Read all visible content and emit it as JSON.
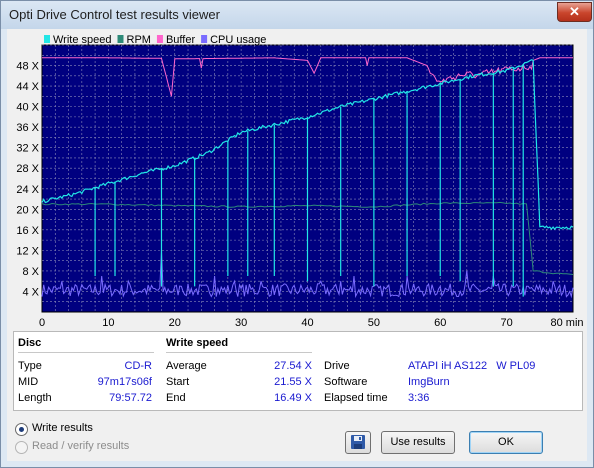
{
  "window": {
    "title": "Opti Drive Control test results viewer",
    "close_glyph": "✕"
  },
  "chart_data": {
    "type": "line",
    "title": "",
    "xlabel": "",
    "ylabel": "",
    "x_unit": "min",
    "xlim": [
      0,
      80
    ],
    "ylim": [
      0,
      52
    ],
    "x_ticks": [
      "0",
      "10",
      "20",
      "30",
      "40",
      "50",
      "60",
      "70",
      "80 min"
    ],
    "y_ticks": [
      "4 X",
      "8 X",
      "12 X",
      "16 X",
      "20 X",
      "24 X",
      "28 X",
      "32 X",
      "36 X",
      "40 X",
      "44 X",
      "48 X"
    ],
    "grid": true,
    "legend_position": "top-left",
    "background": "#000080",
    "series": [
      {
        "name": "Write speed",
        "color": "#22e6e6",
        "points": [
          [
            0,
            21.5
          ],
          [
            5,
            23
          ],
          [
            10,
            25
          ],
          [
            15,
            27
          ],
          [
            20,
            28.5
          ],
          [
            25,
            31
          ],
          [
            30,
            35
          ],
          [
            35,
            36.5
          ],
          [
            40,
            38
          ],
          [
            45,
            40
          ],
          [
            50,
            41.5
          ],
          [
            55,
            43
          ],
          [
            60,
            44.5
          ],
          [
            65,
            46
          ],
          [
            70,
            47
          ],
          [
            72,
            48
          ],
          [
            74,
            49
          ],
          [
            75,
            16.5
          ],
          [
            80,
            16.5
          ]
        ],
        "drops": [
          [
            8,
            7
          ],
          [
            11,
            7
          ],
          [
            18,
            5
          ],
          [
            23,
            5
          ],
          [
            28,
            7
          ],
          [
            31,
            7
          ],
          [
            35,
            7
          ],
          [
            40,
            6
          ],
          [
            45,
            7
          ],
          [
            50,
            5
          ],
          [
            55,
            7
          ],
          [
            60,
            7
          ],
          [
            63,
            6
          ],
          [
            68,
            5
          ],
          [
            71,
            5
          ],
          [
            72.5,
            3
          ]
        ]
      },
      {
        "name": "RPM",
        "color": "#2e8a78",
        "points": [
          [
            0,
            21
          ],
          [
            10,
            21
          ],
          [
            20,
            20.7
          ],
          [
            30,
            20.5
          ],
          [
            40,
            20.7
          ],
          [
            50,
            20.5
          ],
          [
            60,
            21.2
          ],
          [
            70,
            21.2
          ],
          [
            73,
            21
          ],
          [
            74,
            8
          ],
          [
            80,
            7.2
          ]
        ]
      },
      {
        "name": "Buffer",
        "color": "#ff66cc",
        "points": [
          [
            0,
            49.5
          ],
          [
            10,
            49.5
          ],
          [
            18,
            49.4
          ],
          [
            19.5,
            42
          ],
          [
            20,
            49.3
          ],
          [
            35,
            49.5
          ],
          [
            40,
            49
          ],
          [
            41,
            46.5
          ],
          [
            42,
            49.5
          ],
          [
            55,
            49.5
          ],
          [
            58,
            48
          ],
          [
            60,
            45.5
          ],
          [
            63,
            47
          ],
          [
            66,
            47
          ],
          [
            70,
            48
          ],
          [
            73,
            48.5
          ],
          [
            75,
            49.5
          ],
          [
            80,
            49.5
          ]
        ],
        "dips": [
          [
            24,
            47.5
          ],
          [
            41,
            46.5
          ],
          [
            49,
            48
          ],
          [
            61,
            45.5
          ]
        ]
      },
      {
        "name": "CPU usage",
        "color": "#7a6cff",
        "base": 3,
        "spikes": [
          [
            3,
            6
          ],
          [
            7,
            5
          ],
          [
            9,
            7
          ],
          [
            13,
            6
          ],
          [
            18,
            12
          ],
          [
            21,
            5
          ],
          [
            26,
            7
          ],
          [
            29,
            6
          ],
          [
            33,
            6
          ],
          [
            36,
            5
          ],
          [
            42,
            6
          ],
          [
            45,
            6
          ],
          [
            47,
            7
          ],
          [
            51,
            5
          ],
          [
            55,
            7
          ],
          [
            60,
            5
          ],
          [
            64,
            8
          ],
          [
            68,
            7
          ],
          [
            73,
            5
          ],
          [
            77,
            6
          ]
        ]
      }
    ]
  },
  "disc": {
    "header": "Disc",
    "rows": [
      {
        "label": "Type",
        "value": "CD-R"
      },
      {
        "label": "MID",
        "value": "97m17s06f"
      },
      {
        "label": "Length",
        "value": "79:57.72"
      }
    ]
  },
  "write_speed": {
    "header": "Write speed",
    "rows": [
      {
        "label": "Average",
        "value": "27.54 X"
      },
      {
        "label": "Start",
        "value": "21.55 X"
      },
      {
        "label": "End",
        "value": "16.49 X"
      }
    ]
  },
  "drive_info": {
    "rows": [
      {
        "label": "Drive",
        "value": "ATAPI iH AS122   W PL09"
      },
      {
        "label": "Software",
        "value": "ImgBurn"
      },
      {
        "label": "Elapsed time",
        "value": "3:36"
      }
    ]
  },
  "options": {
    "write_results": "Write results",
    "read_verify": "Read / verify results",
    "selected": "write_results"
  },
  "buttons": {
    "save_icon": "floppy-disk-icon",
    "use_results": "Use results",
    "ok": "OK"
  }
}
